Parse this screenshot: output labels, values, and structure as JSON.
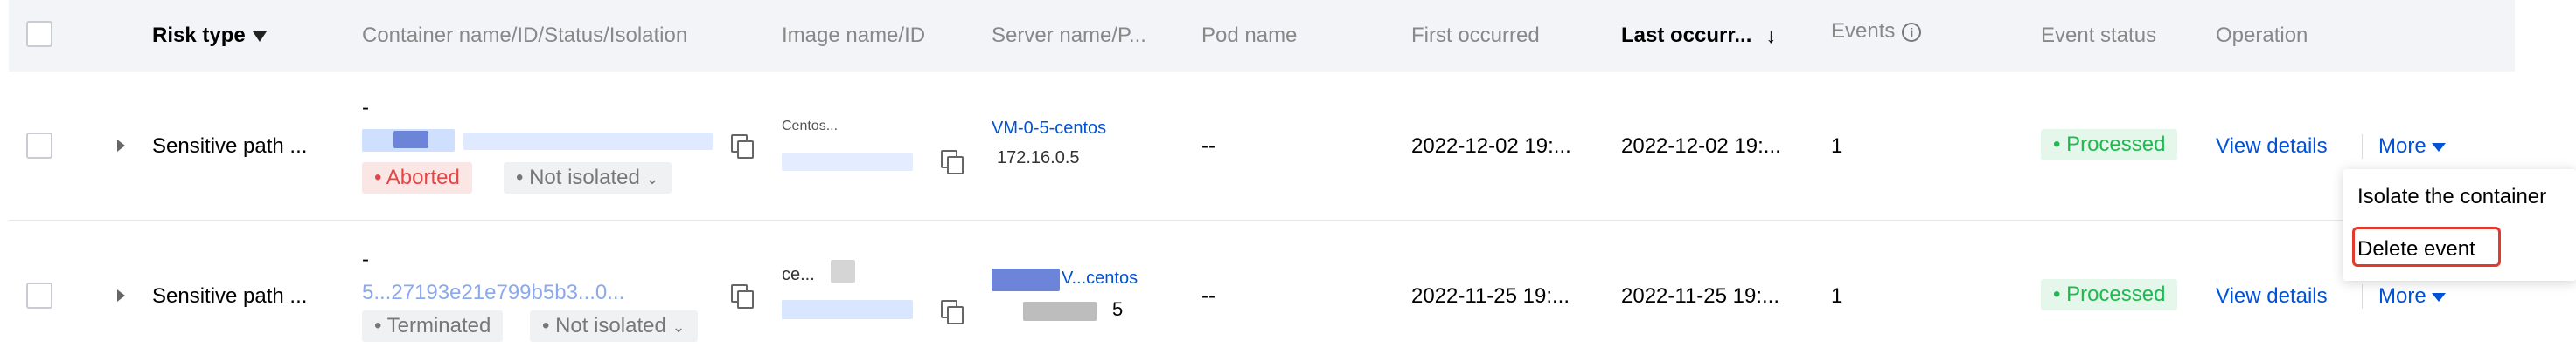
{
  "headers": {
    "risk_type": "Risk type",
    "container": "Container name/ID/Status/Isolation",
    "image": "Image name/ID",
    "server": "Server name/P...",
    "pod": "Pod name",
    "first_occurred": "First occurred",
    "last_occurred": "Last occurr...",
    "events": "Events",
    "event_status": "Event status",
    "operation": "Operation"
  },
  "header_icons": {
    "risk_type": "filter-icon",
    "last_occurred": "sort-descending-icon",
    "events": "info-icon"
  },
  "rows": [
    {
      "risk_type": "Sensitive path ...",
      "container_dash": "-",
      "container_status": "Aborted",
      "container_isolation": "Not isolated",
      "image_name": "Centos...",
      "server_name": "VM-0-5-centos",
      "server_ip": "172.16.0.5",
      "pod": "--",
      "first_occurred": "2022-12-02 19:...",
      "last_occurred": "2022-12-02 19:...",
      "events": "1",
      "event_status": "Processed",
      "view_details": "View details",
      "more": "More"
    },
    {
      "risk_type": "Sensitive path ...",
      "container_dash": "-",
      "container_id": "5...27193e21e799b5b3...0...",
      "container_status": "Terminated",
      "container_isolation": "Not isolated",
      "image_name": "ce...",
      "server_name": "V...centos",
      "server_ip": "5",
      "pod": "--",
      "first_occurred": "2022-11-25 19:...",
      "last_occurred": "2022-11-25 19:...",
      "events": "1",
      "event_status": "Processed",
      "view_details": "View details",
      "more": "More"
    }
  ],
  "dropdown": {
    "isolate": "Isolate the container",
    "delete": "Delete event"
  },
  "colors": {
    "link": "#0052d9",
    "aborted": "#e54545",
    "processed": "#1dbb4f",
    "highlight": "#e33a2e"
  }
}
